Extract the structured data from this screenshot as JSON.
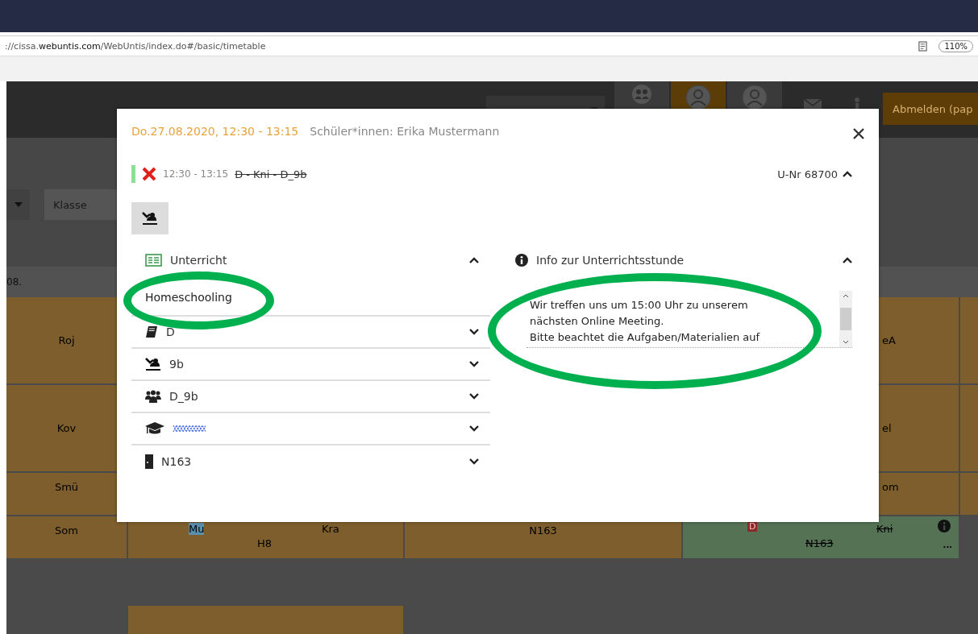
{
  "browser": {
    "url": "://cissa.**webuntis.com**/WebUntis/index.do#/basic/timetable",
    "zoom": "110%"
  },
  "header": {
    "profiles": [
      {
        "kind": "group",
        "selected": false
      },
      {
        "kind": "person",
        "selected": true
      },
      {
        "kind": "person",
        "selected": false
      }
    ],
    "logout": "Abmelden (pap"
  },
  "toolbar": {
    "class_placeholder": "Klasse"
  },
  "timetable": {
    "date_fragment": "08.",
    "rows": [
      {
        "kind": "double",
        "cells": [
          {
            "kind": "lesson",
            "texts": [
              "Roj"
            ]
          },
          {
            "kind": "hidden"
          },
          {
            "kind": "hidden"
          },
          {
            "kind": "lesson",
            "texts": [
              "eA"
            ]
          },
          {
            "kind": "lesson"
          }
        ]
      },
      {
        "kind": "double",
        "cells": [
          {
            "kind": "lesson",
            "texts": [
              "Kov"
            ]
          },
          {
            "kind": "hidden"
          },
          {
            "kind": "hidden"
          },
          {
            "kind": "lesson",
            "texts": [
              "el"
            ]
          },
          {
            "kind": "lesson"
          }
        ]
      },
      {
        "kind": "single",
        "cells": [
          {
            "kind": "lesson",
            "texts": [
              "Smü"
            ]
          },
          {
            "kind": "hidden"
          },
          {
            "kind": "hidden"
          },
          {
            "kind": "lesson",
            "texts": [
              "om"
            ]
          },
          {
            "kind": "lesson"
          }
        ]
      },
      {
        "kind": "single",
        "cells": [
          {
            "kind": "lesson",
            "texts": [
              "Som"
            ]
          },
          {
            "kind": "lesson",
            "texts": [
              "Mu",
              "Kra",
              "H8"
            ]
          },
          {
            "kind": "lesson",
            "texts": [
              "N163"
            ]
          },
          {
            "kind": "cancelled",
            "texts": [
              "D",
              "Kni",
              "N163",
              "..."
            ]
          },
          {
            "kind": "empty"
          }
        ]
      }
    ]
  },
  "dialog": {
    "date_time": "Do.27.08.2020, 12:30 - 13:15",
    "students": "Schüler*innen: Erika Mustermann",
    "lesson": {
      "cancelled": true,
      "time": "12:30 - 13:15",
      "title": "D - Kni - D_9b",
      "number": "U-Nr 68700",
      "expanded": true
    },
    "left_section": {
      "title": "Unterricht",
      "expanded": true,
      "note": "Homeschooling",
      "items": [
        {
          "kind": "subject",
          "label": "D",
          "expanded": false
        },
        {
          "kind": "class",
          "label": "9b",
          "expanded": false
        },
        {
          "kind": "group",
          "label": "D_9b",
          "expanded": false
        },
        {
          "kind": "teacher",
          "expanded": false
        },
        {
          "kind": "room",
          "label": "N163",
          "expanded": false
        }
      ]
    },
    "right_section": {
      "title": "Info zur Unterrichtsstunde",
      "expanded": true,
      "text": "Wir treffen uns um 15:00 Uhr zu unserem\nnächsten Online Meeting.\nBitte beachtet die Aufgaben/Materialien auf"
    }
  }
}
